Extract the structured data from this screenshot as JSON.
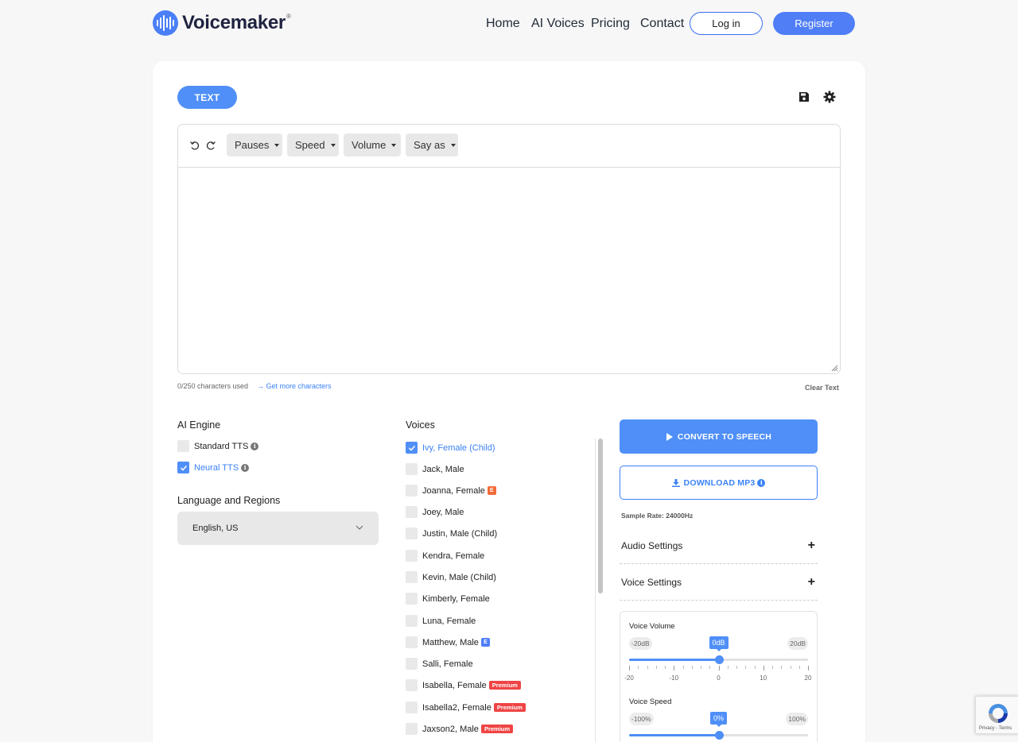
{
  "header": {
    "brand": "Voicemaker",
    "brand_mark": "®",
    "nav": [
      "Home",
      "AI Voices",
      "Pricing",
      "Contact"
    ],
    "login_label": "Log in",
    "register_label": "Register"
  },
  "toolbar": {
    "tab_label": "TEXT",
    "save_icon": "save-icon",
    "settings_icon": "gear-icon"
  },
  "editor": {
    "buttons": [
      "Pauses",
      "Speed",
      "Volume",
      "Say as"
    ],
    "text_value": "",
    "chars_used": "0/250 characters used",
    "get_more": "Get more characters",
    "clear_text": "Clear Text"
  },
  "ai_engine": {
    "title": "AI Engine",
    "options": [
      {
        "label": "Standard TTS",
        "checked": false
      },
      {
        "label": "Neural TTS",
        "checked": true
      }
    ]
  },
  "language": {
    "title": "Language and Regions",
    "selected": "English, US"
  },
  "voices": {
    "title": "Voices",
    "items": [
      {
        "label": "Ivy, Female (Child)",
        "checked": true,
        "badge": ""
      },
      {
        "label": "Jack, Male",
        "checked": false,
        "badge": ""
      },
      {
        "label": "Joanna, Female",
        "checked": false,
        "badge": "E"
      },
      {
        "label": "Joey, Male",
        "checked": false,
        "badge": ""
      },
      {
        "label": "Justin, Male (Child)",
        "checked": false,
        "badge": ""
      },
      {
        "label": "Kendra, Female",
        "checked": false,
        "badge": ""
      },
      {
        "label": "Kevin, Male (Child)",
        "checked": false,
        "badge": ""
      },
      {
        "label": "Kimberly, Female",
        "checked": false,
        "badge": ""
      },
      {
        "label": "Luna, Female",
        "checked": false,
        "badge": ""
      },
      {
        "label": "Matthew, Male",
        "checked": false,
        "badge": "E"
      },
      {
        "label": "Salli, Female",
        "checked": false,
        "badge": ""
      },
      {
        "label": "Isabella, Female",
        "checked": false,
        "badge": "Premium"
      },
      {
        "label": "Isabella2, Female",
        "checked": false,
        "badge": "Premium"
      },
      {
        "label": "Jaxson2, Male",
        "checked": false,
        "badge": "Premium"
      }
    ]
  },
  "actions": {
    "convert": "CONVERT TO SPEECH",
    "download": "DOWNLOAD MP3",
    "sample_rate": "Sample Rate: 24000Hz"
  },
  "settings": {
    "audio": "Audio Settings",
    "voice": "Voice Settings",
    "plus": "+"
  },
  "voice_volume": {
    "title": "Voice Volume",
    "min_label": "-20dB",
    "max_label": "20dB",
    "value_label": "0dB",
    "value": 0,
    "min": -20,
    "max": 20,
    "tick_labels": [
      "-20",
      "-10",
      "0",
      "10",
      "20"
    ]
  },
  "voice_speed": {
    "title": "Voice Speed",
    "min_label": "-100%",
    "max_label": "100%",
    "value_label": "0%",
    "value": 0,
    "min": -100,
    "max": 100
  },
  "recaptcha": {
    "text": "Privacy - Terms"
  },
  "colors": {
    "accent": "#4f8ff7",
    "brand": "#4a7ff7",
    "premium": "#ef4444",
    "badge_e": "#f26b3a"
  }
}
